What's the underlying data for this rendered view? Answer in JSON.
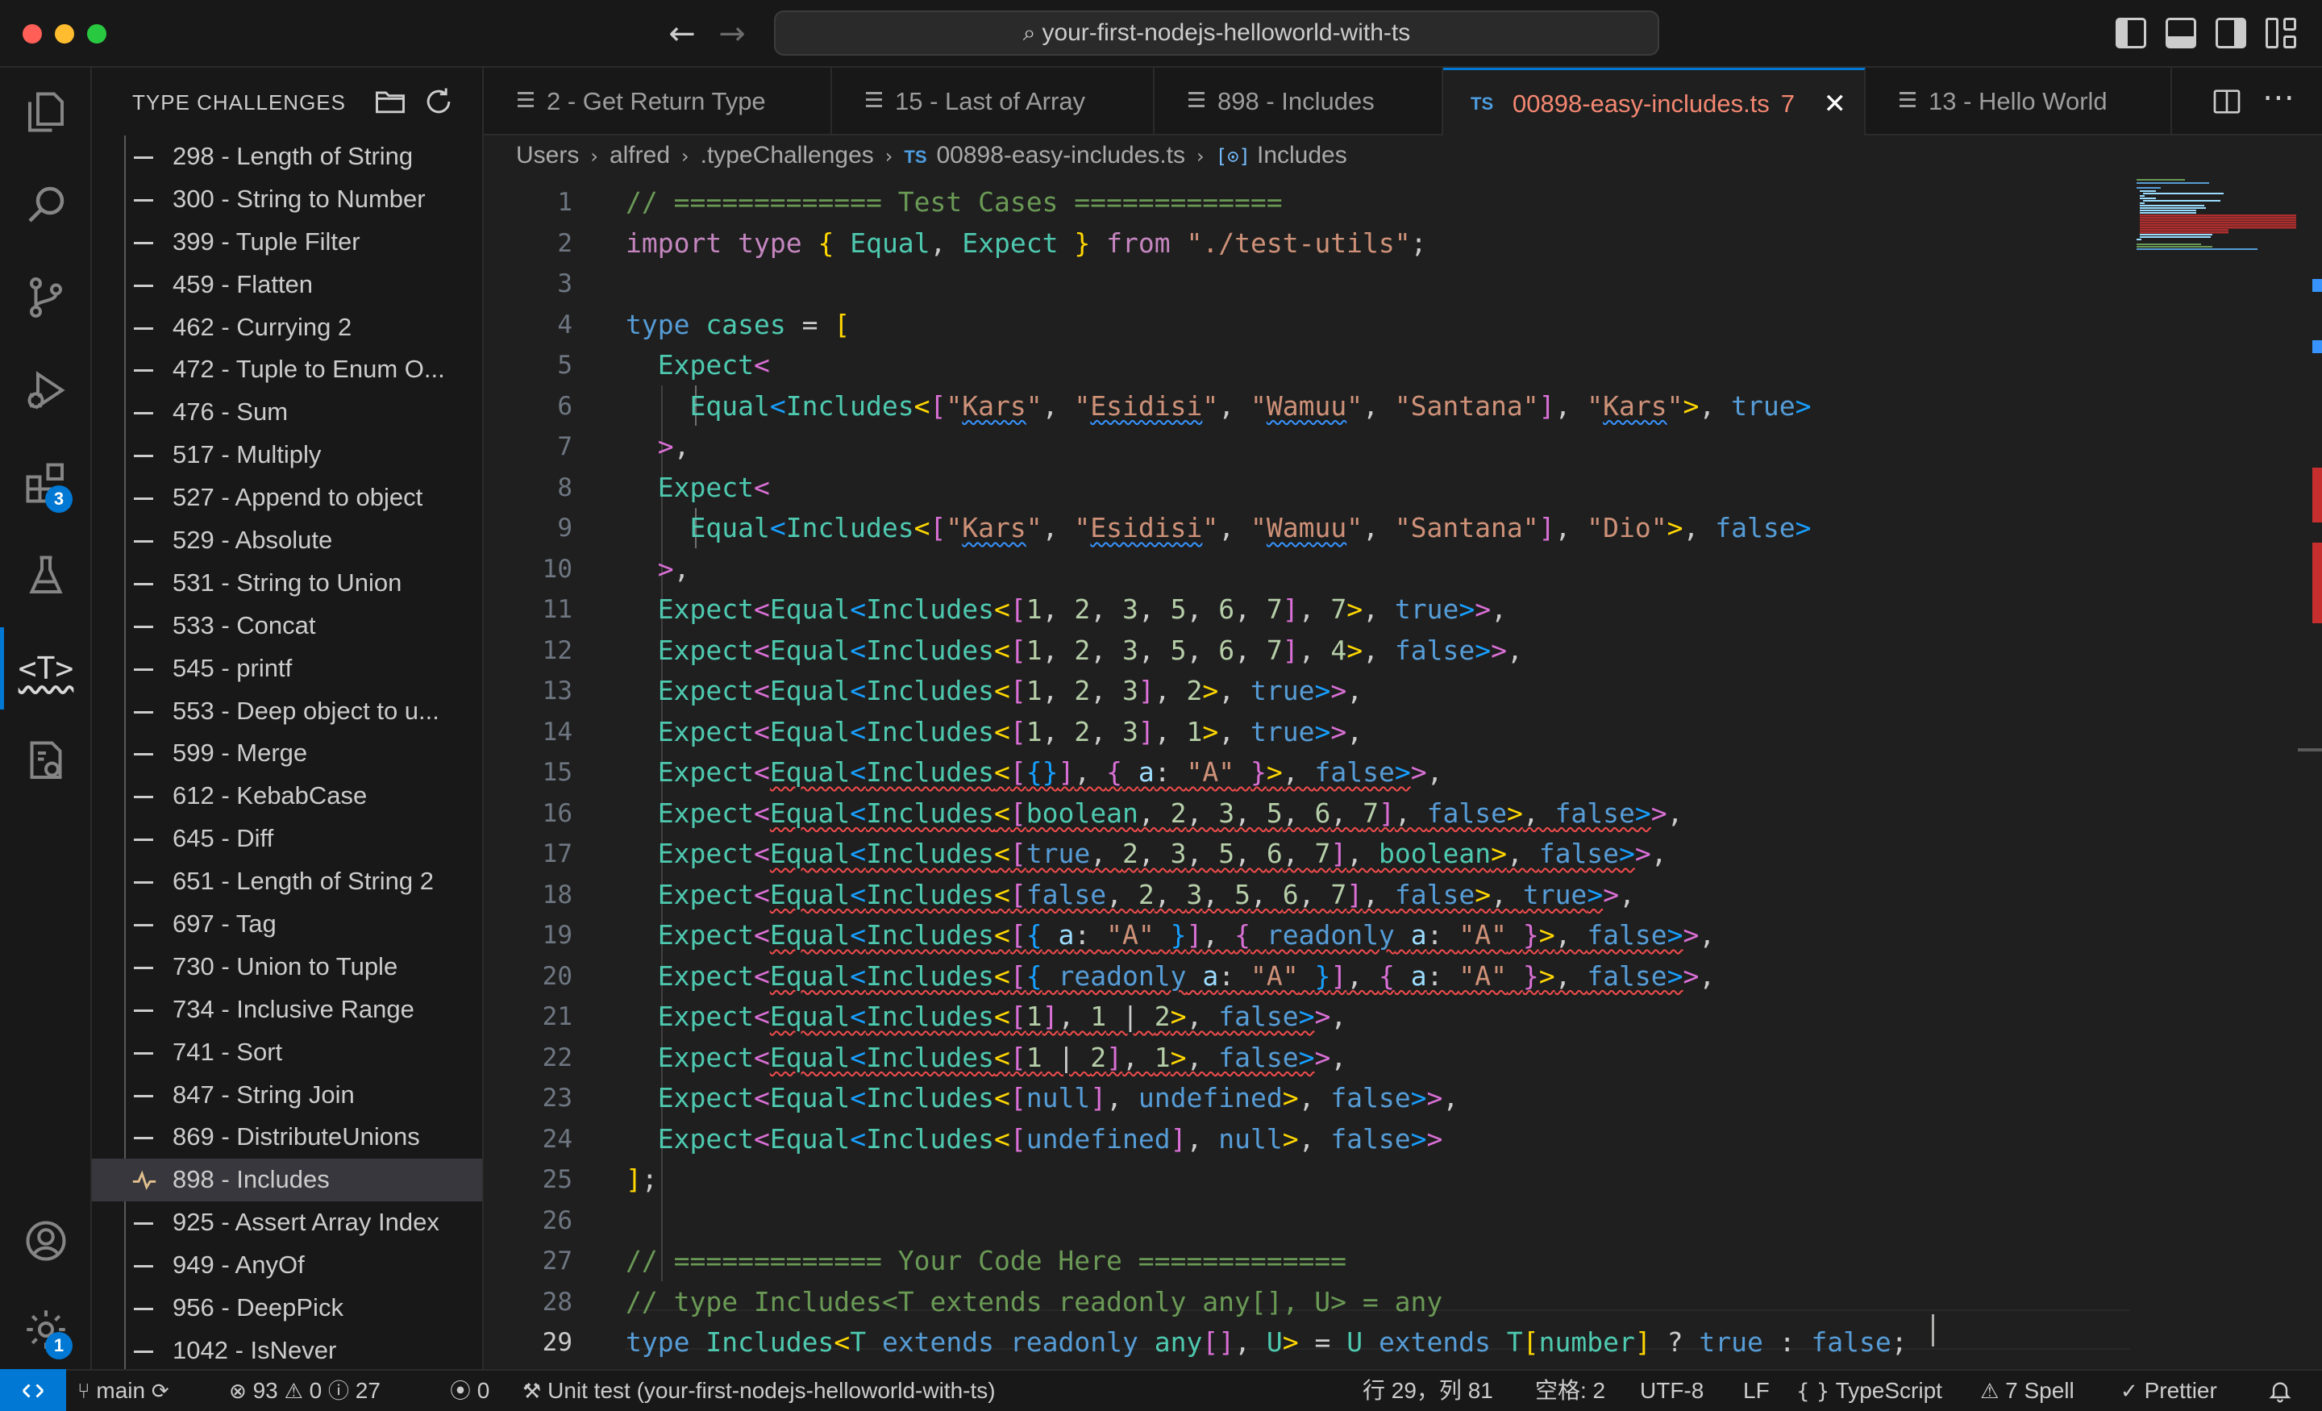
{
  "window": {
    "command_center": "your-first-nodejs-helloworld-with-ts"
  },
  "activity_bar": {
    "extensions_badge": "3",
    "manage_badge": "1",
    "type_challenges_icon_text": "<T>"
  },
  "sidebar": {
    "title": "TYPE CHALLENGES",
    "items": [
      {
        "label": "298 - Length of String"
      },
      {
        "label": "300 - String to Number"
      },
      {
        "label": "399 - Tuple Filter"
      },
      {
        "label": "459 - Flatten"
      },
      {
        "label": "462 - Currying 2"
      },
      {
        "label": "472 - Tuple to Enum O..."
      },
      {
        "label": "476 - Sum"
      },
      {
        "label": "517 - Multiply"
      },
      {
        "label": "527 - Append to object"
      },
      {
        "label": "529 - Absolute"
      },
      {
        "label": "531 - String to Union"
      },
      {
        "label": "533 - Concat"
      },
      {
        "label": "545 - printf"
      },
      {
        "label": "553 - Deep object to u..."
      },
      {
        "label": "599 - Merge"
      },
      {
        "label": "612 - KebabCase"
      },
      {
        "label": "645 - Diff"
      },
      {
        "label": "651 - Length of String 2"
      },
      {
        "label": "697 - Tag"
      },
      {
        "label": "730 - Union to Tuple"
      },
      {
        "label": "734 - Inclusive Range"
      },
      {
        "label": "741 - Sort"
      },
      {
        "label": "847 - String Join"
      },
      {
        "label": "869 - DistributeUnions"
      },
      {
        "label": "898 - Includes"
      },
      {
        "label": "925 - Assert Array Index"
      },
      {
        "label": "949 - AnyOf"
      },
      {
        "label": "956 - DeepPick"
      },
      {
        "label": "1042 - IsNever"
      }
    ],
    "selected_label": "898 - Includes"
  },
  "tabs": [
    {
      "label": "2 - Get Return Type"
    },
    {
      "label": "15 - Last of Array"
    },
    {
      "label": "898 - Includes"
    },
    {
      "label": "00898-easy-includes.ts",
      "problems": "7",
      "lang": "TS"
    },
    {
      "label": "13 - Hello World"
    }
  ],
  "breadcrumbs": {
    "parts": [
      "Users",
      "alfred",
      ".typeChallenges",
      "00898-easy-includes.ts",
      "Includes"
    ],
    "lang": "TS"
  },
  "editor": {
    "line_numbers": [
      "1",
      "2",
      "3",
      "4",
      "5",
      "6",
      "7",
      "8",
      "9",
      "10",
      "11",
      "12",
      "13",
      "14",
      "15",
      "16",
      "17",
      "18",
      "19",
      "20",
      "21",
      "22",
      "23",
      "24",
      "25",
      "26",
      "27",
      "28",
      "29"
    ],
    "current_line": "29"
  },
  "statusbar": {
    "branch": "main",
    "errors": "93",
    "warnings": "0",
    "infos": "27",
    "ports": "0",
    "task": "Unit test (your-first-nodejs-helloworld-with-ts)",
    "cursor_position": "行 29，列 81",
    "indent": "空格: 2",
    "encoding": "UTF-8",
    "eol": "LF",
    "language": "TypeScript",
    "spell": "7 Spell",
    "formatter": "Prettier"
  },
  "colors": {
    "accent": "#0078d4",
    "error": "#f14c4c",
    "tab_error_text": "#f48771"
  }
}
